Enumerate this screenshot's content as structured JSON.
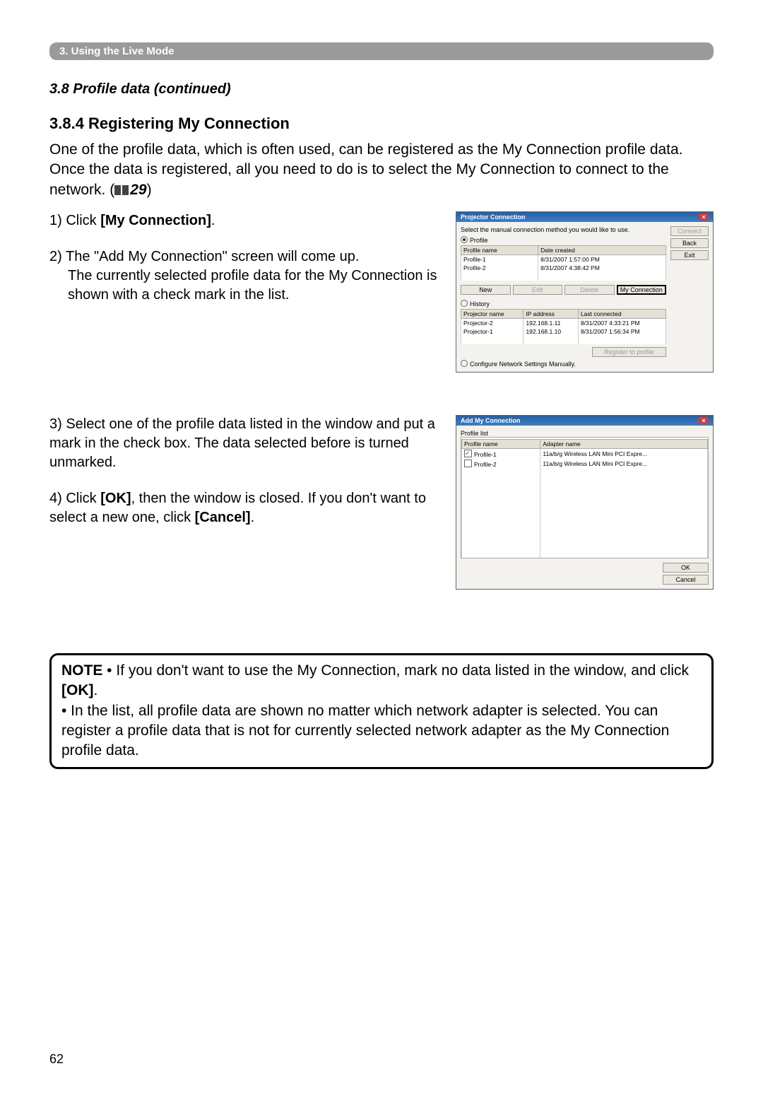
{
  "sectionBar": "3. Using the Live Mode",
  "subheadItalic": "3.8 Profile data (continued)",
  "h3": "3.8.4 Registering My Connection",
  "intro1": "One of the profile data, which is often used, can be registered as the My Connection profile data. Once the data is registered, all you need to do is to select the My Connection to connect to the network. (",
  "introRef": "29",
  "introTail": ")",
  "step1_pre": "1) Click ",
  "step1_bold": "[My Connection]",
  "step1_tail": ".",
  "step2a": "2) The \"Add My Connection\" screen will come up.",
  "step2b": "The currently selected profile data for the My Connection is shown with a check mark in the list.",
  "step3": "3) Select one of the profile data listed in the window and put a mark in the check box. The data selected before is turned unmarked.",
  "step4_pre": "4) Click ",
  "step4_b1": "[OK]",
  "step4_mid": ", then the window is closed. If you don't want to select a new one, click ",
  "step4_b2": "[Cancel]",
  "step4_tail": ".",
  "dlg1": {
    "title": "Projector Connection",
    "caption": "Select the manual connection method you would like to use.",
    "radioProfile": "Profile",
    "radioHistory": "History",
    "profHeaders": [
      "Profile name",
      "Date created"
    ],
    "profRows": [
      [
        "Profile-1",
        "8/31/2007 1:57:00 PM"
      ],
      [
        "Profile-2",
        "8/31/2007 4:38:42 PM"
      ]
    ],
    "btnNew": "New",
    "btnEdit": "Edit",
    "btnDelete": "Delete",
    "btnMyConn": "My Connection",
    "histHeaders": [
      "Projector name",
      "IP address",
      "Last connected"
    ],
    "histRows": [
      [
        "Projector-2",
        "192.168.1.11",
        "8/31/2007 4:33:21 PM"
      ],
      [
        "Projector-1",
        "192.168.1.10",
        "8/31/2007 1:56:34 PM"
      ]
    ],
    "regBtn": "Register to profile",
    "manual": "Configure Network Settings Manually.",
    "side": {
      "connect": "Connect",
      "back": "Back",
      "exit": "Exit"
    }
  },
  "dlg2": {
    "title": "Add My Connection",
    "listLabel": "Profile list",
    "headers": [
      "Profile name",
      "Adapter name"
    ],
    "rows": [
      {
        "checked": true,
        "name": "Profile-1",
        "adapter": "11a/b/g Wireless LAN Mini PCI Expre..."
      },
      {
        "checked": false,
        "name": "Profile-2",
        "adapter": "11a/b/g Wireless LAN Mini PCI Expre..."
      }
    ],
    "ok": "OK",
    "cancel": "Cancel"
  },
  "noteLabel": "NOTE",
  "note1_pre": "  •  If you don't want to use the My Connection, mark no data listed in the window, and click ",
  "note1_b": "[OK]",
  "note1_tail": ".",
  "note2": "• In the list, all profile data are shown no matter which network adapter is selected. You can register a profile data that is not for currently selected network adapter as the My Connection profile data.",
  "pageNumber": "62"
}
